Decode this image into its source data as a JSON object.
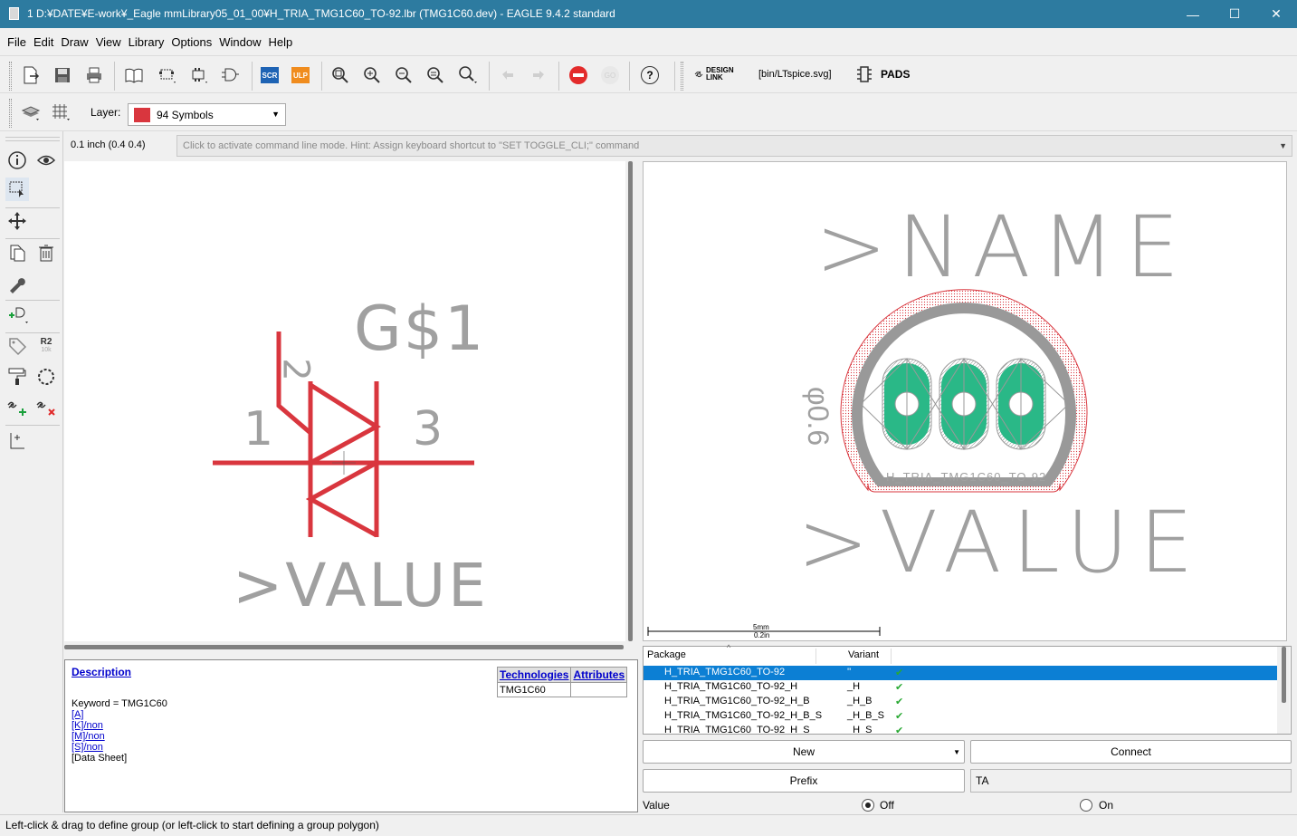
{
  "window": {
    "title": "1 D:¥DATE¥E-work¥_Eagle mmLibrary05_01_00¥H_TRIA_TMG1C60_TO-92.lbr (TMG1C60.dev) - EAGLE 9.4.2 standard",
    "minimize": "—",
    "maximize": "☐",
    "close": "✕"
  },
  "menu": [
    "File",
    "Edit",
    "Draw",
    "View",
    "Library",
    "Options",
    "Window",
    "Help"
  ],
  "toolbar": {
    "scr_label": "SCR",
    "ulp_label": "ULP",
    "go_label": "GO",
    "help_label": "?",
    "design_link_label_1": "DESIGN",
    "design_link_label_2": "LINK",
    "ltspice_label": "[bin/LTspice.svg]",
    "pads_label": "PADS"
  },
  "toolbar2": {
    "layer_label": "Layer:",
    "layer_value": "94 Symbols",
    "layer_color": "#d9363e"
  },
  "coordinates": "0.1 inch (0.4 0.4)",
  "command_line": {
    "placeholder": "Click to activate command line mode. Hint: Assign keyboard shortcut to \"SET TOGGLE_CLI;\" command"
  },
  "left_tools": {
    "r2_label": "R2",
    "r2_sub": "10k"
  },
  "symbol": {
    "name_text": "G$1",
    "value_text": ">VALUE",
    "pin_left": "1",
    "pin_right": "3",
    "pin_top": "2",
    "color": "#d9363e",
    "text_color": "#a0a0a0"
  },
  "package": {
    "name_text": ">NAME",
    "value_text": ">VALUE",
    "dim_text": "φ0.6",
    "silk_text": "H_TRIA_TMG1C60_TO-92",
    "scale_mm": "5mm",
    "scale_in": "0.2in",
    "pad_color": "#2ab887",
    "outline_color": "#999999",
    "keepout_color": "#d9363e"
  },
  "description": {
    "title": "Description",
    "keyword": "Keyword = TMG1C60",
    "links": [
      "[A]",
      "[K]/non",
      "[M]/non",
      "[S]/non"
    ],
    "datasheet": "[Data Sheet]",
    "tech_headers": [
      "Technologies",
      "Attributes"
    ],
    "tech_rows": [
      [
        "TMG1C60",
        ""
      ]
    ]
  },
  "package_table": {
    "headers": [
      "Package",
      "Variant"
    ],
    "rows": [
      {
        "package": "H_TRIA_TMG1C60_TO-92",
        "variant": "''",
        "check": "✔",
        "selected": true
      },
      {
        "package": "H_TRIA_TMG1C60_TO-92_H",
        "variant": "_H",
        "check": "✔",
        "selected": false
      },
      {
        "package": "H_TRIA_TMG1C60_TO-92_H_B",
        "variant": "_H_B",
        "check": "✔",
        "selected": false
      },
      {
        "package": "H_TRIA_TMG1C60_TO-92_H_B_S",
        "variant": "_H_B_S",
        "check": "✔",
        "selected": false
      },
      {
        "package": "H_TRIA_TMG1C60_TO-92_H_S",
        "variant": "_H_S",
        "check": "✔",
        "selected": false
      }
    ]
  },
  "buttons": {
    "new": "New",
    "connect": "Connect",
    "prefix": "Prefix",
    "prefix_value": "TA"
  },
  "value_row": {
    "label": "Value",
    "off": "Off",
    "on": "On",
    "selected": "Off"
  },
  "status": "Left-click & drag to define group (or left-click to start defining a group polygon)"
}
